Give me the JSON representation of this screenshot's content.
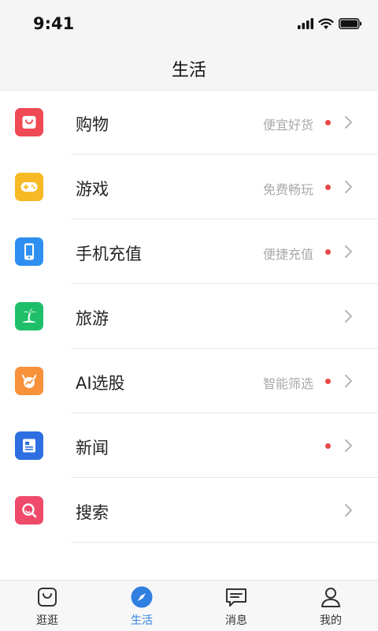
{
  "status": {
    "time": "9:41"
  },
  "header": {
    "title": "生活"
  },
  "list": [
    {
      "label": "购物",
      "subtitle": "便宜好货",
      "dot": true,
      "icon": "shopping-bag-icon",
      "color": "#f04a55"
    },
    {
      "label": "游戏",
      "subtitle": "免费畅玩",
      "dot": true,
      "icon": "gamepad-icon",
      "color": "#f7b924"
    },
    {
      "label": "手机充值",
      "subtitle": "便捷充值",
      "dot": true,
      "icon": "phone-icon",
      "color": "#2e8ff0"
    },
    {
      "label": "旅游",
      "subtitle": "",
      "dot": false,
      "icon": "palm-tree-icon",
      "color": "#1fbf6a"
    },
    {
      "label": "AI选股",
      "subtitle": "智能筛选",
      "dot": true,
      "icon": "bull-chart-icon",
      "color": "#f7913a"
    },
    {
      "label": "新闻",
      "subtitle": "",
      "dot": true,
      "icon": "newspaper-icon",
      "color": "#2d6fe0"
    },
    {
      "label": "搜索",
      "subtitle": "",
      "dot": false,
      "icon": "search-icon",
      "color": "#ef4a6a"
    }
  ],
  "tabbar": {
    "tabs": [
      {
        "label": "逛逛",
        "icon": "bag-icon",
        "active": false
      },
      {
        "label": "生活",
        "icon": "compass-icon",
        "active": true
      },
      {
        "label": "消息",
        "icon": "message-icon",
        "active": false
      },
      {
        "label": "我的",
        "icon": "user-icon",
        "active": false
      }
    ]
  },
  "colors": {
    "accent": "#2f7fe0",
    "dot": "#e84a4a",
    "subtitle": "#a9a9a9"
  }
}
